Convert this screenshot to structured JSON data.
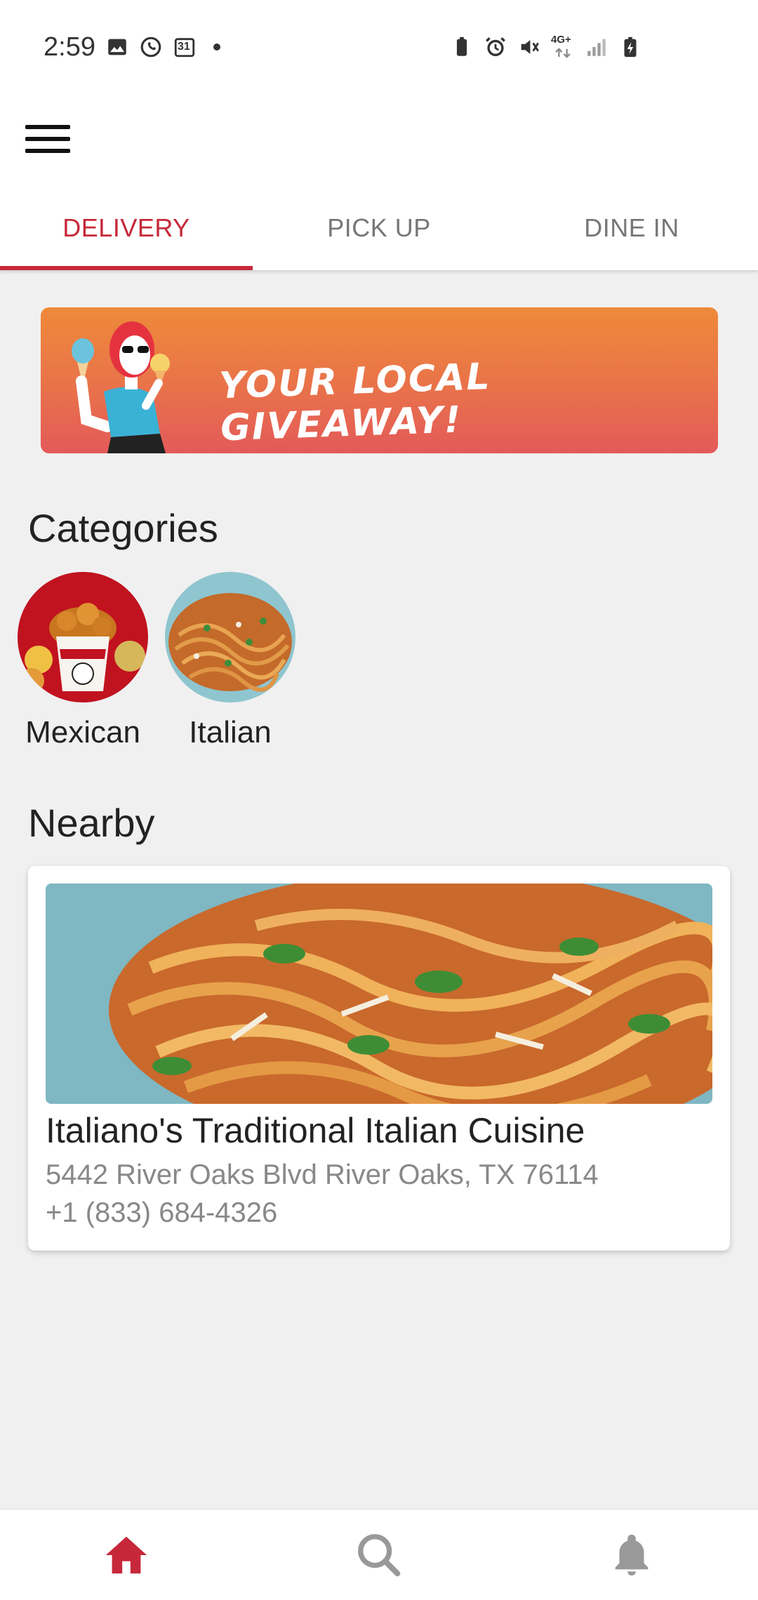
{
  "status_bar": {
    "time": "2:59",
    "left_icons": [
      "gallery-icon",
      "whatsapp-icon",
      "calendar-icon"
    ],
    "calendar_day": "31",
    "right_icons": [
      "battery-saver-icon",
      "alarm-icon",
      "mute-icon",
      "network-4g-icon",
      "signal-icon",
      "battery-charging-icon"
    ],
    "network_label": "4G+"
  },
  "app_bar": {
    "menu_icon": "hamburger-menu-icon"
  },
  "tabs": [
    {
      "label": "DELIVERY",
      "active": true
    },
    {
      "label": "PICK UP",
      "active": false
    },
    {
      "label": "DINE IN",
      "active": false
    }
  ],
  "banner": {
    "text": "Your Local Giveaway!"
  },
  "categories": {
    "title": "Categories",
    "items": [
      {
        "label": "Mexican"
      },
      {
        "label": "Italian"
      }
    ]
  },
  "nearby": {
    "title": "Nearby",
    "restaurants": [
      {
        "name": "Italiano's Traditional Italian Cuisine",
        "address": "5442 River Oaks Blvd River Oaks, TX 76114",
        "phone": "+1 (833) 684-4326"
      }
    ]
  },
  "bottom_nav": [
    {
      "icon": "home-icon",
      "active": true
    },
    {
      "icon": "search-icon",
      "active": false
    },
    {
      "icon": "bell-icon",
      "active": false
    }
  ],
  "colors": {
    "accent": "#c6283a",
    "banner_top": "#ee8a3a",
    "banner_bottom": "#e35a5a",
    "background": "#f0f0f0"
  }
}
